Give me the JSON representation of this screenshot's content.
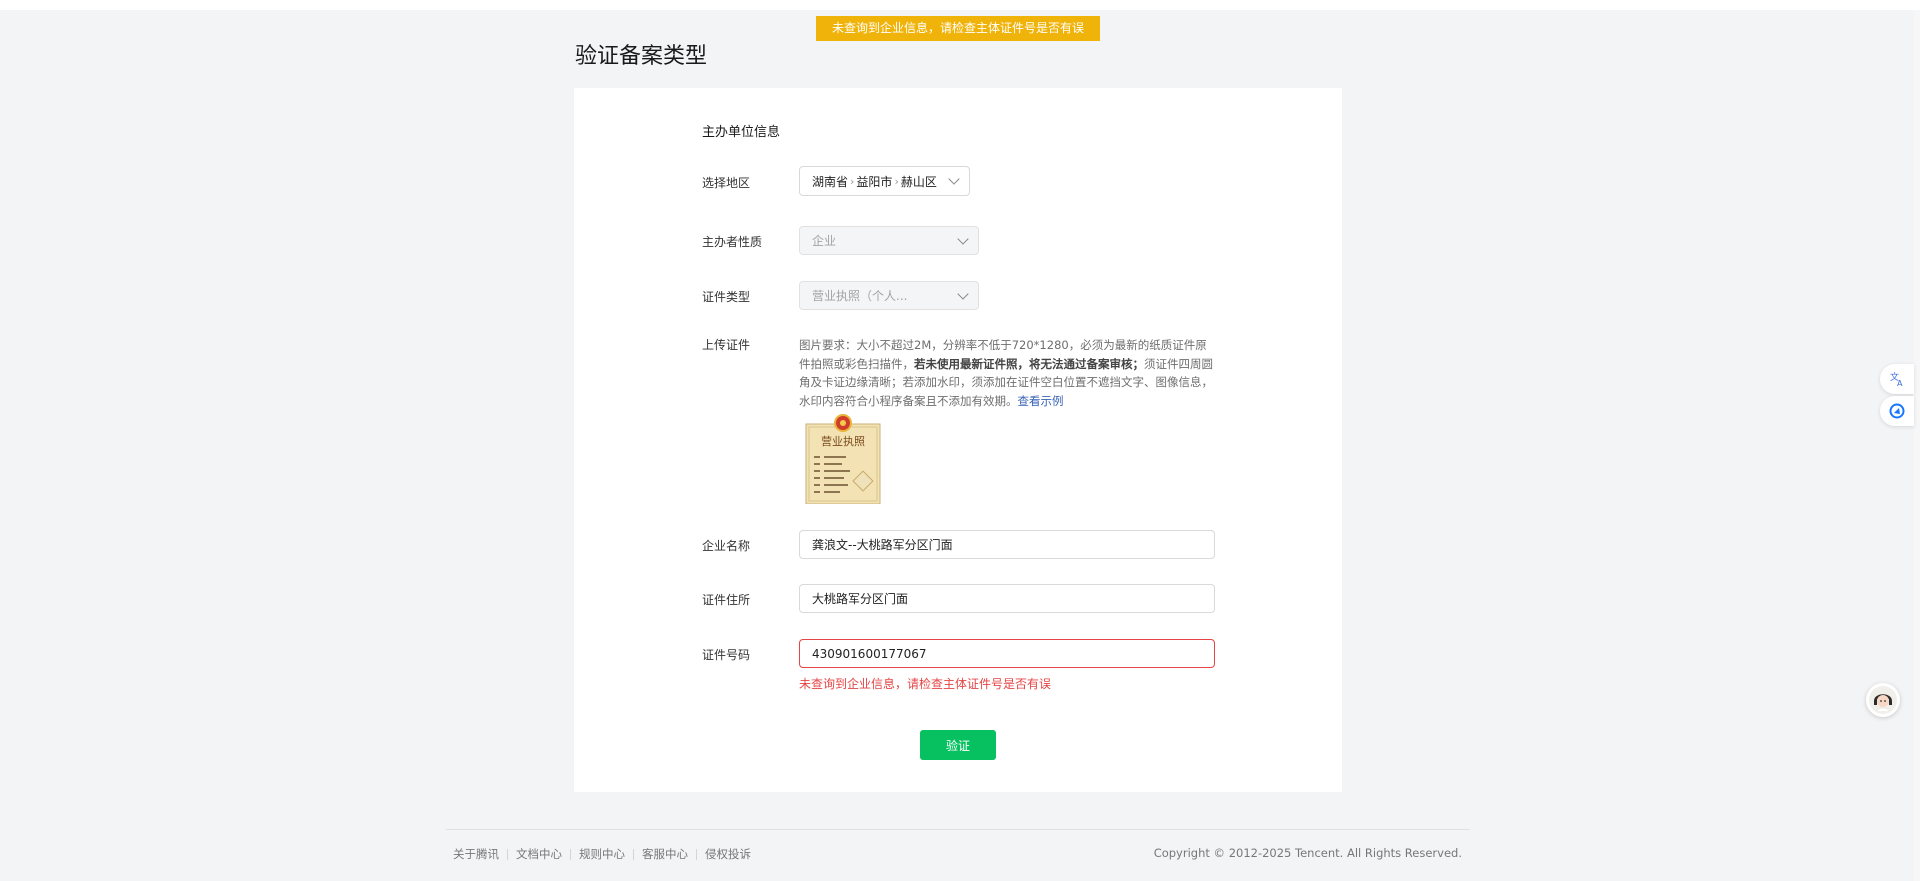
{
  "toast": {
    "message": "未查询到企业信息，请检查主体证件号是否有误"
  },
  "page": {
    "title": "验证备案类型"
  },
  "form": {
    "section_title": "主办单位信息",
    "region": {
      "label": "选择地区",
      "province": "湖南省",
      "city": "益阳市",
      "district": "赫山区"
    },
    "organizer_type": {
      "label": "主办者性质",
      "value": "企业"
    },
    "cert_type": {
      "label": "证件类型",
      "value": "营业执照（个人..."
    },
    "upload": {
      "label": "上传证件",
      "hint_part1": "图片要求：大小不超过2M，分辨率不低于720*1280，必须为最新的纸质证件原件拍照或彩色扫描件，",
      "hint_bold": "若未使用最新证件照，将无法通过备案审核；",
      "hint_part2": "须证件四周圆角及卡证边缘清晰；若添加水印，须添加在证件空白位置不遮挡文字、图像信息，水印内容符合小程序备案且不添加有效期。",
      "example_link": "查看示例",
      "thumb_title": "营业执照"
    },
    "company_name": {
      "label": "企业名称",
      "value": "龚浪文--大桃路军分区门面"
    },
    "cert_address": {
      "label": "证件住所",
      "value": "大桃路军分区门面"
    },
    "cert_number": {
      "label": "证件号码",
      "value": "430901600177067",
      "error": "未查询到企业信息，请检查主体证件号是否有误"
    },
    "submit_label": "验证"
  },
  "footer": {
    "links": [
      "关于腾讯",
      "文档中心",
      "规则中心",
      "客服中心",
      "侵权投诉"
    ],
    "copyright": "Copyright © 2012-2025 Tencent. All Rights Reserved."
  },
  "colors": {
    "toast": "#f0b30a",
    "primary": "#07c160",
    "error": "#e54545",
    "link": "#3a63b5"
  }
}
